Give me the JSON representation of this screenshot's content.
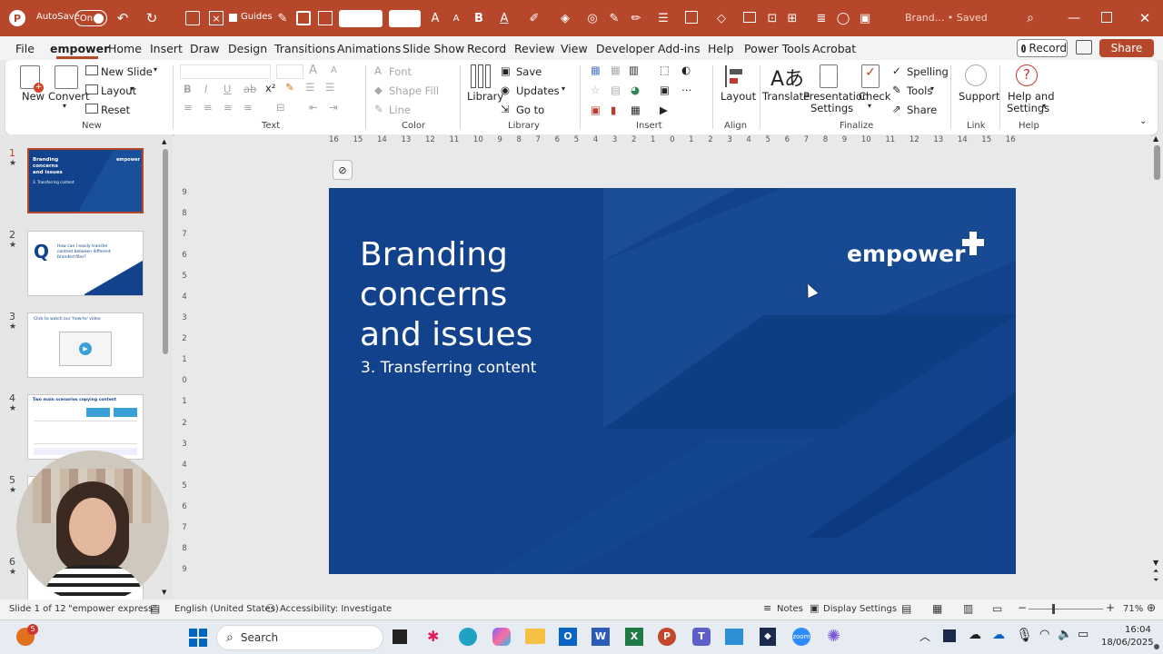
{
  "titlebar": {
    "autosave_label": "AutoSave",
    "autosave_state": "On",
    "guides_label": "Guides",
    "document_title": "Brand... • Saved",
    "bg_color": "#b7472a"
  },
  "menu": [
    "File",
    "empower",
    "Home",
    "Insert",
    "Draw",
    "Design",
    "Transitions",
    "Animations",
    "Slide Show",
    "Record",
    "Review",
    "View",
    "Developer",
    "Add-ins",
    "Help",
    "Power Tools",
    "Acrobat"
  ],
  "menu_active": "empower",
  "record_button": "Record",
  "share_button": "Share",
  "ribbon": {
    "new": "New",
    "convert": "Convert",
    "new_slide": "New Slide",
    "layout_dd": "Layout",
    "reset": "Reset",
    "group_new": "New",
    "font": "Font",
    "shape_fill": "Shape Fill",
    "line": "Line",
    "group_text": "Text",
    "group_color": "Color",
    "library": "Library",
    "save": "Save",
    "updates": "Updates",
    "goto": "Go to",
    "group_library": "Library",
    "group_insert": "Insert",
    "layout": "Layout",
    "group_align": "Align",
    "translate": "Translate",
    "presentation_settings_1": "Presentation",
    "presentation_settings_2": "Settings",
    "check": "Check",
    "spelling": "Spelling",
    "tools": "Tools",
    "share": "Share",
    "group_finalize": "Finalize",
    "support": "Support",
    "group_link": "Link",
    "help_settings_1": "Help and",
    "help_settings_2": "Settings",
    "group_help": "Help"
  },
  "ruler_h": [
    "16",
    "15",
    "14",
    "13",
    "12",
    "11",
    "10",
    "9",
    "8",
    "7",
    "6",
    "5",
    "4",
    "3",
    "2",
    "1",
    "0",
    "1",
    "2",
    "3",
    "4",
    "5",
    "6",
    "7",
    "8",
    "9",
    "10",
    "11",
    "12",
    "13",
    "14",
    "15",
    "16"
  ],
  "ruler_v": [
    "9",
    "8",
    "7",
    "6",
    "5",
    "4",
    "3",
    "2",
    "1",
    "0",
    "1",
    "2",
    "3",
    "4",
    "5",
    "6",
    "7",
    "8",
    "9"
  ],
  "thumbnails": [
    {
      "num": "1",
      "title": "Branding concerns and issues",
      "sub": "3. Transferring content",
      "brand": "empower"
    },
    {
      "num": "2",
      "letter": "Q",
      "text": "How can I easily transfer content between different branded files?"
    },
    {
      "num": "3",
      "text": "Click to watch our 'how-to' video"
    },
    {
      "num": "4",
      "text": "Two main scenarios copying content"
    },
    {
      "num": "5"
    },
    {
      "num": "6"
    }
  ],
  "slide": {
    "title_line1": "Branding",
    "title_line2": "concerns",
    "title_line3": "and issues",
    "subtitle": "3. Transferring content",
    "brand": "empower",
    "bg_color": "#11428b"
  },
  "status": {
    "slide_count": "Slide 1 of 12",
    "theme": "\"empower express\"",
    "language": "English (United States)",
    "accessibility": "Accessibility: Investigate",
    "notes": "Notes",
    "display_settings": "Display Settings",
    "zoom": "71%"
  },
  "taskbar": {
    "badge": "5",
    "search_placeholder": "Search",
    "time": "16:04",
    "date": "18/06/2025"
  },
  "colors": {
    "accent": "#b7472a",
    "slide_blue": "#11428b",
    "win_blue": "#0067c0"
  }
}
